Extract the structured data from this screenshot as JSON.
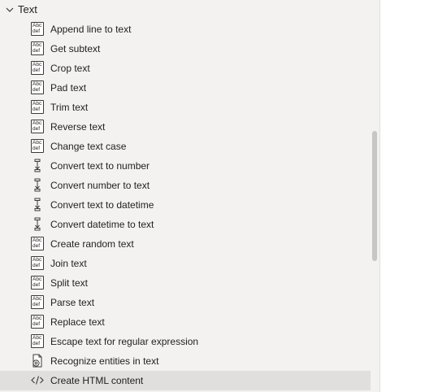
{
  "group": {
    "title": "Text",
    "icon": "chevron-down-icon"
  },
  "items": [
    {
      "label": "Append line to text",
      "icon": "text-abc-icon"
    },
    {
      "label": "Get subtext",
      "icon": "text-abc-icon"
    },
    {
      "label": "Crop text",
      "icon": "text-abc-icon"
    },
    {
      "label": "Pad text",
      "icon": "text-abc-icon"
    },
    {
      "label": "Trim text",
      "icon": "text-abc-icon"
    },
    {
      "label": "Reverse text",
      "icon": "text-abc-icon"
    },
    {
      "label": "Change text case",
      "icon": "text-abc-icon"
    },
    {
      "label": "Convert text to number",
      "icon": "convert-icon"
    },
    {
      "label": "Convert number to text",
      "icon": "convert-icon"
    },
    {
      "label": "Convert text to datetime",
      "icon": "convert-icon"
    },
    {
      "label": "Convert datetime to text",
      "icon": "convert-icon"
    },
    {
      "label": "Create random text",
      "icon": "text-abc-icon"
    },
    {
      "label": "Join text",
      "icon": "text-abc-icon"
    },
    {
      "label": "Split text",
      "icon": "text-abc-icon"
    },
    {
      "label": "Parse text",
      "icon": "text-abc-icon"
    },
    {
      "label": "Replace text",
      "icon": "text-abc-icon"
    },
    {
      "label": "Escape text for regular expression",
      "icon": "text-abc-icon"
    },
    {
      "label": "Recognize entities in text",
      "icon": "recognize-entities-icon"
    },
    {
      "label": "Create HTML content",
      "icon": "code-icon",
      "selected": true
    }
  ],
  "abc_icon_text": {
    "top": "Abc",
    "bottom": "def"
  },
  "colors": {
    "panel_background": "#f3f2f1",
    "selected_background": "#e1dfdd",
    "text": "#201f1e",
    "scrollbar": "#c8c6c4"
  }
}
